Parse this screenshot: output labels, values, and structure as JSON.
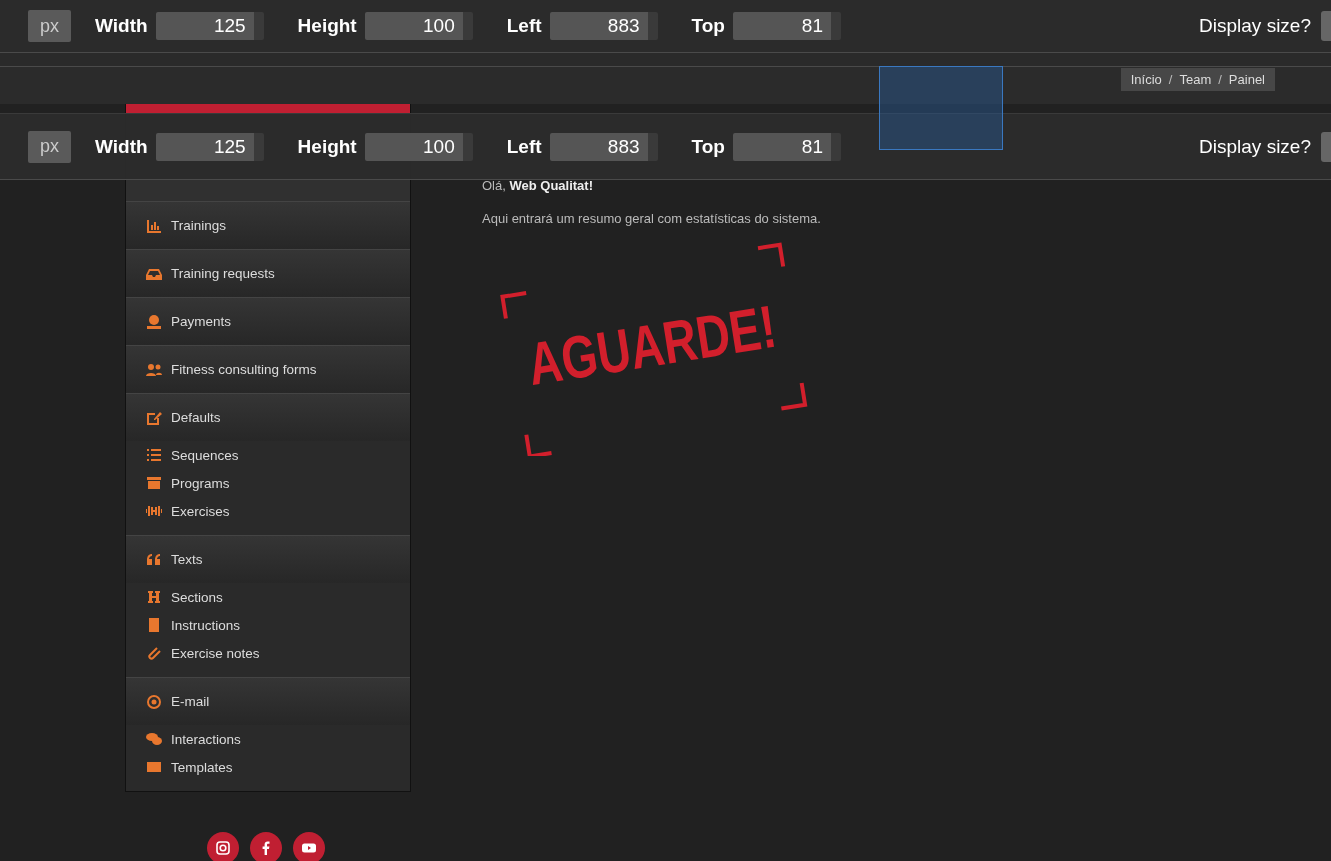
{
  "measure_toolbars": [
    {
      "unit": "px",
      "fields": [
        {
          "label": "Width",
          "value": "125"
        },
        {
          "label": "Height",
          "value": "100"
        },
        {
          "label": "Left",
          "value": "883"
        },
        {
          "label": "Top",
          "value": "81"
        }
      ],
      "display_size_label": "Display size?"
    },
    {
      "unit": "px",
      "fields": [
        {
          "label": "Width",
          "value": "125"
        },
        {
          "label": "Height",
          "value": "100"
        },
        {
          "label": "Left",
          "value": "883"
        },
        {
          "label": "Top",
          "value": "81"
        }
      ],
      "display_size_label": "Display size?"
    }
  ],
  "breadcrumb": {
    "separator": "/",
    "items": [
      "Início",
      "Team",
      "Painel"
    ]
  },
  "sidebar": {
    "items": [
      {
        "label": "Trainings"
      },
      {
        "label": "Training requests"
      },
      {
        "label": "Payments"
      },
      {
        "label": "Fitness consulting forms"
      },
      {
        "label": "Defaults",
        "children": [
          {
            "label": "Sequences"
          },
          {
            "label": "Programs"
          },
          {
            "label": "Exercises"
          }
        ]
      },
      {
        "label": "Texts",
        "children": [
          {
            "label": "Sections"
          },
          {
            "label": "Instructions"
          },
          {
            "label": "Exercise notes"
          }
        ]
      },
      {
        "label": "E-mail",
        "children": [
          {
            "label": "Interactions"
          },
          {
            "label": "Templates"
          }
        ]
      }
    ]
  },
  "content": {
    "greeting": "Olá, **Web Qualitat!**",
    "description": "Aqui entrará um resumo geral com estatísticas do sistema.",
    "stamp": "AGUARDE!"
  }
}
